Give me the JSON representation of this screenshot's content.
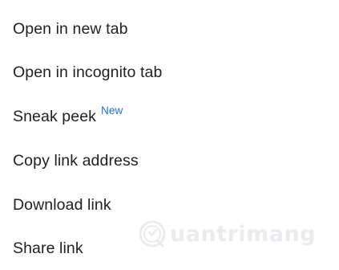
{
  "menu": {
    "items": [
      {
        "label": "Open in new tab"
      },
      {
        "label": "Open in incognito tab"
      },
      {
        "label": "Sneak peek",
        "badge": "New"
      },
      {
        "label": "Copy link address"
      },
      {
        "label": "Download link"
      },
      {
        "label": "Share link"
      }
    ]
  },
  "watermark": {
    "text": "uantrimang"
  },
  "colors": {
    "text": "#202124",
    "badge": "#1a73e8",
    "background": "#ffffff",
    "watermark": "#d9dde2"
  }
}
